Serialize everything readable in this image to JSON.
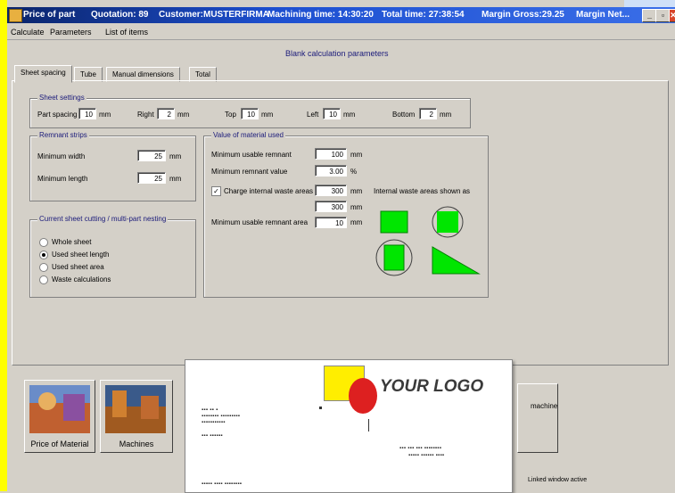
{
  "titlebar": {
    "title": "Price of part",
    "quotation": "Quotation: 89",
    "customer": "Customer:MUSTERFIRMA",
    "machining_time": "Machining time: 14:30:20",
    "total_time": "Total time: 27:38:54",
    "margin_gross": "Margin Gross:29.25",
    "margin_net": "Margin Net..."
  },
  "menu": [
    "Calculate",
    "Parameters",
    "List of items"
  ],
  "section_title": "Blank calculation parameters",
  "tabs": [
    "Sheet spacing",
    "Tube",
    "Manual dimensions",
    "Total"
  ],
  "sheet_spacing": {
    "title": "Sheet settings",
    "fields": [
      {
        "label": "Part spacing",
        "value": "10",
        "unit": "mm"
      },
      {
        "label": "Right",
        "value": "2",
        "unit": "mm"
      },
      {
        "label": "Top",
        "value": "10",
        "unit": "mm"
      },
      {
        "label": "Left",
        "value": "10",
        "unit": "mm"
      },
      {
        "label": "Bottom",
        "value": "2",
        "unit": "mm"
      }
    ]
  },
  "remnant": {
    "title": "Remnant strips",
    "fields": [
      {
        "label": "Minimum width",
        "value": "25",
        "unit": "mm"
      },
      {
        "label": "Minimum length",
        "value": "25",
        "unit": "mm"
      }
    ]
  },
  "material_used": {
    "title": "Value of material used",
    "fields": [
      {
        "label": "Minimum usable remnant",
        "value": "100",
        "unit": "mm"
      },
      {
        "label": "Minimum remnant value",
        "value": "3.00",
        "unit": "%"
      },
      {
        "label": "Charge internal waste areas",
        "value": "300",
        "unit": "mm",
        "checked": true
      },
      {
        "label": "",
        "value": "300",
        "unit": "mm"
      },
      {
        "label": "Minimum usable remnant area",
        "value": "10",
        "unit": "mm"
      }
    ],
    "shapes_label": "Internal waste areas shown as"
  },
  "cutting": {
    "title": "Current sheet cutting / multi-part nesting",
    "options": [
      {
        "label": "Whole sheet",
        "selected": false
      },
      {
        "label": "Used sheet length",
        "selected": true
      },
      {
        "label": "Used sheet area",
        "selected": false
      },
      {
        "label": "Waste calculations",
        "selected": false
      }
    ]
  },
  "tiles": [
    {
      "label": "Price of Material"
    },
    {
      "label": "Machines"
    }
  ],
  "paper": {
    "logo": "YOUR LOGO"
  },
  "right_tile_text": "machine",
  "bottom_right_text": "Linked window active"
}
